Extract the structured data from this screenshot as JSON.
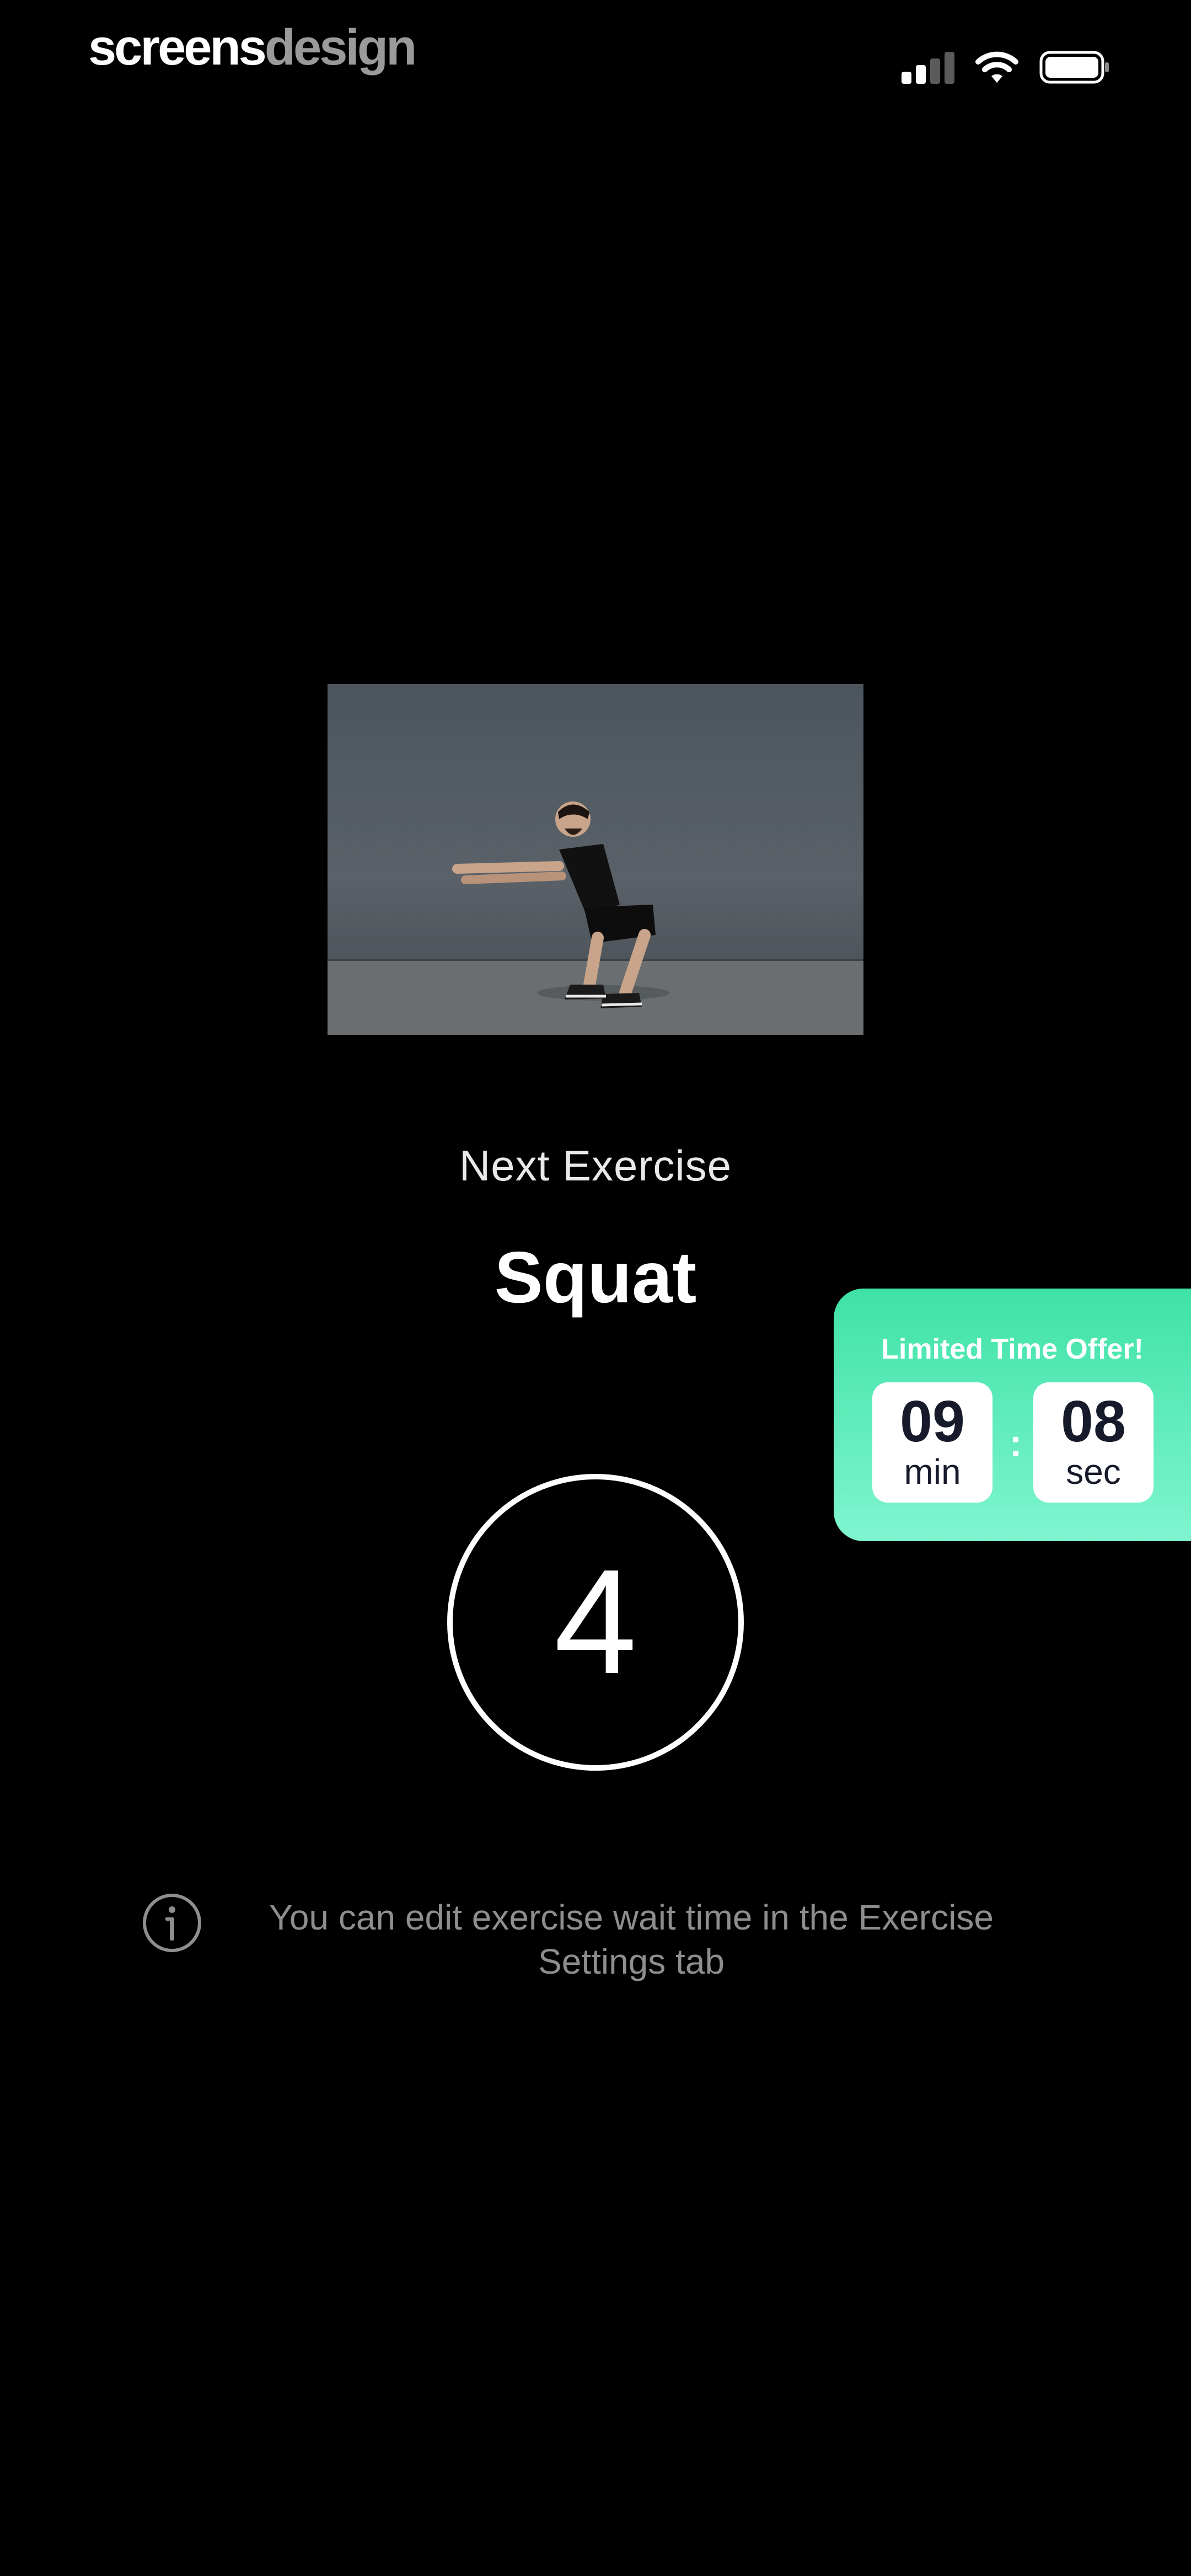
{
  "status_bar": {
    "brand_part1": "screens",
    "brand_part2": "design"
  },
  "preview": {
    "image": "person-squatting-with-arms-extended"
  },
  "exercise": {
    "next_label": "Next Exercise",
    "name": "Squat",
    "countdown": "4"
  },
  "offer": {
    "title": "Limited Time Offer!",
    "minutes": "09",
    "minutes_unit": "min",
    "separator": ":",
    "seconds": "08",
    "seconds_unit": "sec",
    "gradient_top": "#3fe2a6",
    "gradient_bottom": "#7ff5d0"
  },
  "info": {
    "icon": "info-icon",
    "text": "You can edit exercise wait time in the Exercise Settings tab"
  }
}
